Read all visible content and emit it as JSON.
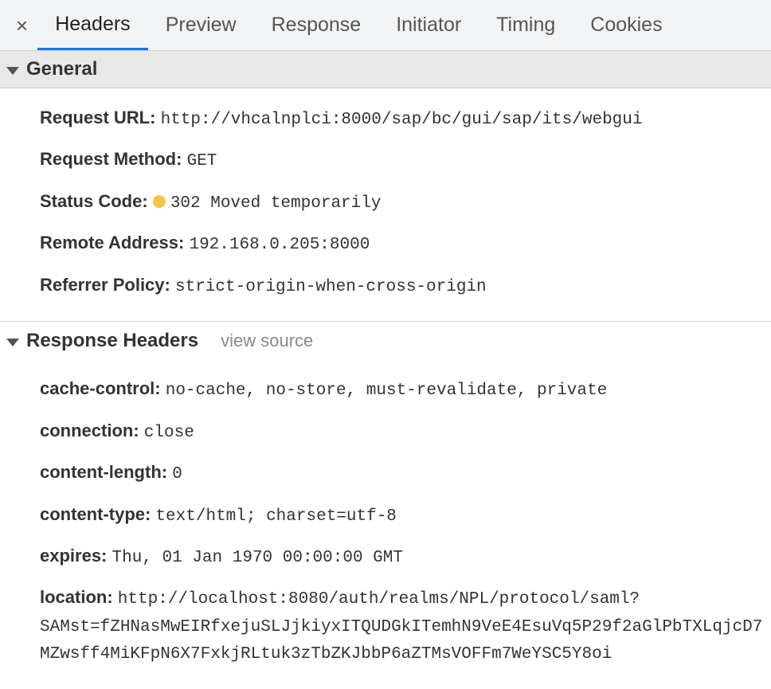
{
  "tabs": [
    "Headers",
    "Preview",
    "Response",
    "Initiator",
    "Timing",
    "Cookies"
  ],
  "activeTab": 0,
  "sections": {
    "general": {
      "title": "General"
    },
    "responseHeaders": {
      "title": "Response Headers",
      "viewSourceLabel": "view source"
    }
  },
  "general": {
    "requestUrl": {
      "label": "Request URL:",
      "value": "http://vhcalnplci:8000/sap/bc/gui/sap/its/webgui"
    },
    "requestMethod": {
      "label": "Request Method:",
      "value": "GET"
    },
    "statusCode": {
      "label": "Status Code:",
      "value": "302 Moved temporarily",
      "statusColor": "#f6c343"
    },
    "remoteAddress": {
      "label": "Remote Address:",
      "value": "192.168.0.205:8000"
    },
    "referrerPolicy": {
      "label": "Referrer Policy:",
      "value": "strict-origin-when-cross-origin"
    }
  },
  "responseHeaders": {
    "cacheControl": {
      "label": "cache-control:",
      "value": "no-cache, no-store, must-revalidate, private"
    },
    "connection": {
      "label": "connection:",
      "value": "close"
    },
    "contentLength": {
      "label": "content-length:",
      "value": "0"
    },
    "contentType": {
      "label": "content-type:",
      "value": "text/html; charset=utf-8"
    },
    "expires": {
      "label": "expires:",
      "value": "Thu, 01 Jan 1970 00:00:00 GMT"
    },
    "location": {
      "label": "location:",
      "value": "http://localhost:8080/auth/realms/NPL/protocol/saml?SAMst=fZHNasMwEIRfxejuSLJjkiyxITQUDGkITemhN9VeE4EsuVq5P29f2aGlPbTXLqjcD7MZwsff4MiKFpN6X7FxkjRLtuk3zTbZKJbbP6aZTMsVOFFm7WeYSC5Y8oi"
    }
  }
}
